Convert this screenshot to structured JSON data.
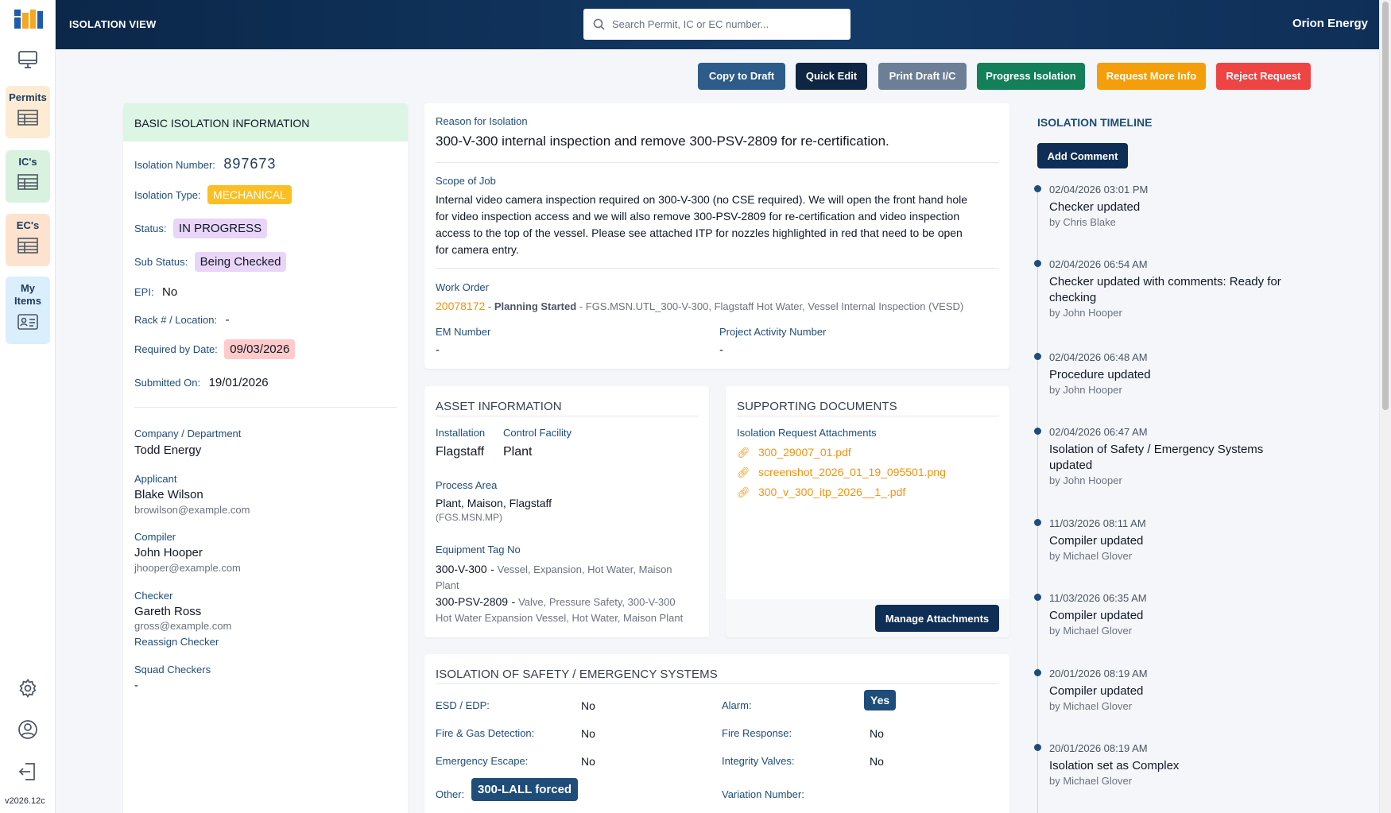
{
  "app": {
    "version": "v2026.12c"
  },
  "nav": {
    "permits": "Permits",
    "ics": "IC's",
    "ecs": "EC's",
    "my_items_1": "My",
    "my_items_2": "Items"
  },
  "header": {
    "title": "ISOLATION VIEW",
    "search_placeholder": "Search Permit, IC or EC number...",
    "org": "Orion Energy"
  },
  "actions": {
    "copy": "Copy to Draft",
    "quick_edit": "Quick Edit",
    "print": "Print Draft I/C",
    "progress": "Progress Isolation",
    "more_info": "Request More Info",
    "reject": "Reject Request"
  },
  "basic": {
    "title": "BASIC ISOLATION INFORMATION",
    "number_label": "Isolation Number:",
    "number": "897673",
    "type_label": "Isolation Type:",
    "type": "MECHANICAL",
    "status_label": "Status:",
    "status": "IN PROGRESS",
    "sub_status_label": "Sub Status:",
    "sub_status": "Being Checked",
    "epi_label": "EPI:",
    "epi": "No",
    "rack_label": "Rack # / Location:",
    "rack": "-",
    "required_label": "Required by Date:",
    "required": "09/03/2026",
    "submitted_label": "Submitted On:",
    "submitted": "19/01/2026",
    "company_label": "Company / Department",
    "company": "Todd Energy",
    "applicant_label": "Applicant",
    "applicant": "Blake Wilson",
    "applicant_email": "browilson@example.com",
    "compiler_label": "Compiler",
    "compiler": "John Hooper",
    "compiler_email": "jhooper@example.com",
    "checker_label": "Checker",
    "checker": "Gareth Ross",
    "checker_email": "gross@example.com",
    "reassign": "Reassign Checker",
    "squad_label": "Squad Checkers",
    "squad": "-"
  },
  "reason": {
    "label": "Reason for Isolation",
    "text": "300-V-300 internal inspection and remove 300-PSV-2809 for re-certification.",
    "scope_label": "Scope of Job",
    "scope_1": "Internal video camera inspection required on 300-V-300 (no CSE required). We will open the front hand hole",
    "scope_2": "for video inspection access and we will also remove 300-PSV-2809 for re-certification and video inspection",
    "scope_3": "access to the top of the vessel. Please see attached ITP for nozzles highlighted in red that need to be open",
    "scope_4": "for camera entry.",
    "wo_label": "Work Order",
    "wo_number": "20078172",
    "wo_status": "Planning Started",
    "wo_desc": "FGS.MSN.UTL_300-V-300, Flagstaff Hot Water, Vessel Internal Inspection (VESD)",
    "em_label": "EM Number",
    "em": "-",
    "pa_label": "Project Activity Number",
    "pa": "-"
  },
  "asset": {
    "title": "ASSET INFORMATION",
    "installation_label": "Installation",
    "installation": "Flagstaff",
    "control_label": "Control Facility",
    "control": "Plant",
    "process_label": "Process Area",
    "process": "Plant, Maison, Flagstaff",
    "process_code": "(FGS.MSN.MP)",
    "equip_label": "Equipment Tag No",
    "tag1": "300-V-300",
    "tag1_desc_1": "Vessel, Expansion, Hot Water, Maison",
    "tag1_desc_2": "Plant",
    "tag2": "300-PSV-2809",
    "tag2_desc_1": "Valve, Pressure Safety, 300-V-300",
    "tag2_desc_2": "Hot Water Expansion Vessel, Hot Water, Maison Plant"
  },
  "docs": {
    "title": "SUPPORTING DOCUMENTS",
    "attach_label": "Isolation Request Attachments",
    "files": [
      "300_29007_01.pdf",
      "screenshot_2026_01_19_095501.png",
      "300_v_300_itp_2026__1_.pdf"
    ],
    "manage": "Manage Attachments"
  },
  "safety": {
    "title": "ISOLATION OF SAFETY / EMERGENCY SYSTEMS",
    "esd_label": "ESD / EDP:",
    "esd": "No",
    "alarm_label": "Alarm:",
    "alarm": "Yes",
    "fg_label": "Fire & Gas Detection:",
    "fg": "No",
    "fr_label": "Fire Response:",
    "fr": "No",
    "ee_label": "Emergency Escape:",
    "ee": "No",
    "iv_label": "Integrity Valves:",
    "iv": "No",
    "other_label": "Other:",
    "other": "300-LALL forced",
    "var_label": "Variation Number:"
  },
  "timeline": {
    "title": "ISOLATION TIMELINE",
    "add": "Add Comment",
    "items": [
      {
        "date": "02/04/2026 03:01 PM",
        "text": "Checker updated",
        "text2": "",
        "by": "by Chris Blake"
      },
      {
        "date": "02/04/2026 06:54 AM",
        "text": "Checker updated with comments: Ready for",
        "text2": "checking",
        "by": "by John Hooper"
      },
      {
        "date": "02/04/2026 06:48 AM",
        "text": "Procedure updated",
        "text2": "",
        "by": "by John Hooper"
      },
      {
        "date": "02/04/2026 06:47 AM",
        "text": "Isolation of Safety / Emergency Systems",
        "text2": "updated",
        "by": "by John Hooper"
      },
      {
        "date": "11/03/2026 08:11 AM",
        "text": "Compiler updated",
        "text2": "",
        "by": "by Michael Glover"
      },
      {
        "date": "11/03/2026 06:35 AM",
        "text": "Compiler updated",
        "text2": "",
        "by": "by Michael Glover"
      },
      {
        "date": "20/01/2026 08:19 AM",
        "text": "Compiler updated",
        "text2": "",
        "by": "by Michael Glover"
      },
      {
        "date": "20/01/2026 08:19 AM",
        "text": "Isolation set as Complex",
        "text2": "",
        "by": "by Michael Glover"
      }
    ]
  }
}
